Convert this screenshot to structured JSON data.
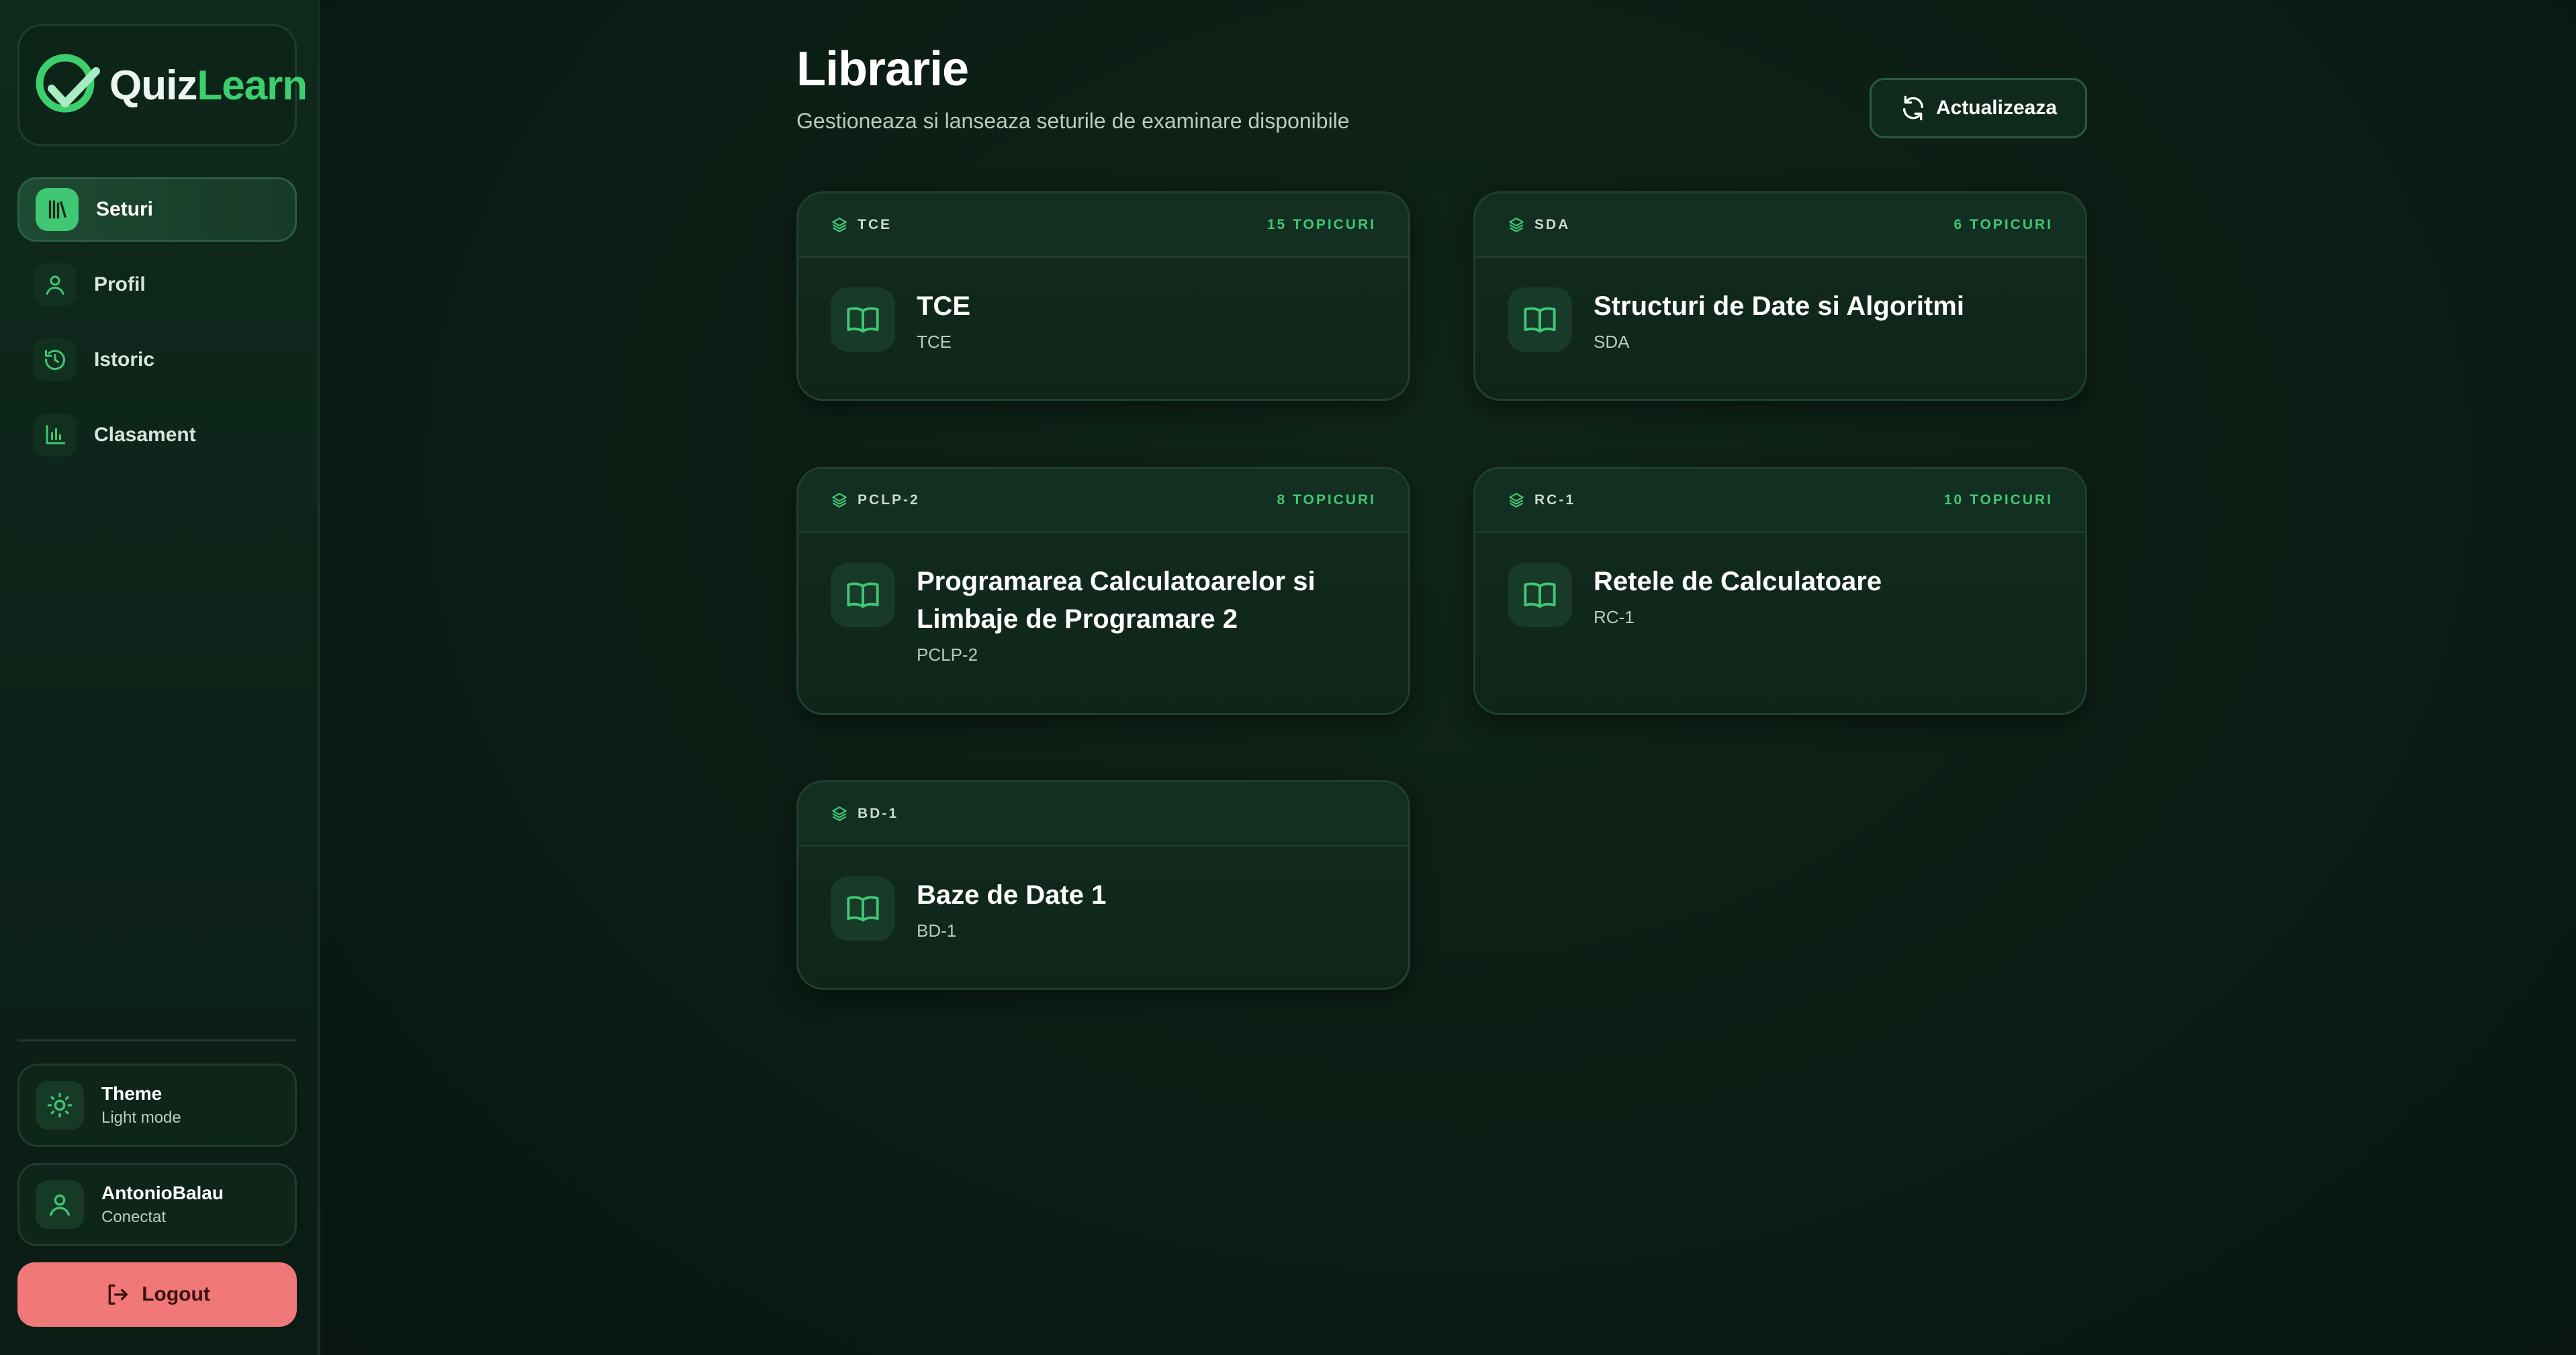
{
  "app": {
    "name_part1": "Quiz",
    "name_part2": "Learn"
  },
  "sidebar": {
    "items": [
      {
        "label": "Seturi",
        "icon": "library-icon",
        "active": true
      },
      {
        "label": "Profil",
        "icon": "user-icon",
        "active": false
      },
      {
        "label": "Istoric",
        "icon": "history-icon",
        "active": false
      },
      {
        "label": "Clasament",
        "icon": "bar-chart-icon",
        "active": false
      }
    ],
    "theme": {
      "title": "Theme",
      "subtitle": "Light mode",
      "icon": "sun-icon"
    },
    "user": {
      "name": "AntonioBalau",
      "status": "Conectat",
      "icon": "user-icon"
    },
    "logout": {
      "label": "Logout",
      "icon": "logout-icon"
    }
  },
  "main": {
    "title": "Librarie",
    "subtitle": "Gestioneaza si lanseaza seturile de examinare disponibile",
    "refresh_label": "Actualizeaza",
    "cards": [
      {
        "code": "TCE",
        "topics": "15 TOPICURI",
        "title": "TCE",
        "subtitle": "TCE"
      },
      {
        "code": "SDA",
        "topics": "6 TOPICURI",
        "title": "Structuri de Date si Algoritmi",
        "subtitle": "SDA"
      },
      {
        "code": "PCLP-2",
        "topics": "8 TOPICURI",
        "title_line1": "Programarea Calculatoarelor si",
        "title_line2": "Limbaje de Programare 2",
        "subtitle": "PCLP-2"
      },
      {
        "code": "RC-1",
        "topics": "10 TOPICURI",
        "title": "Retele de Calculatoare",
        "subtitle": "RC-1"
      },
      {
        "code": "BD-1",
        "topics": "",
        "title": "Baze de Date 1",
        "subtitle": "BD-1"
      }
    ]
  },
  "colors": {
    "accent": "#3fc774",
    "background": "#0a1a12",
    "logout": "#f07878"
  }
}
